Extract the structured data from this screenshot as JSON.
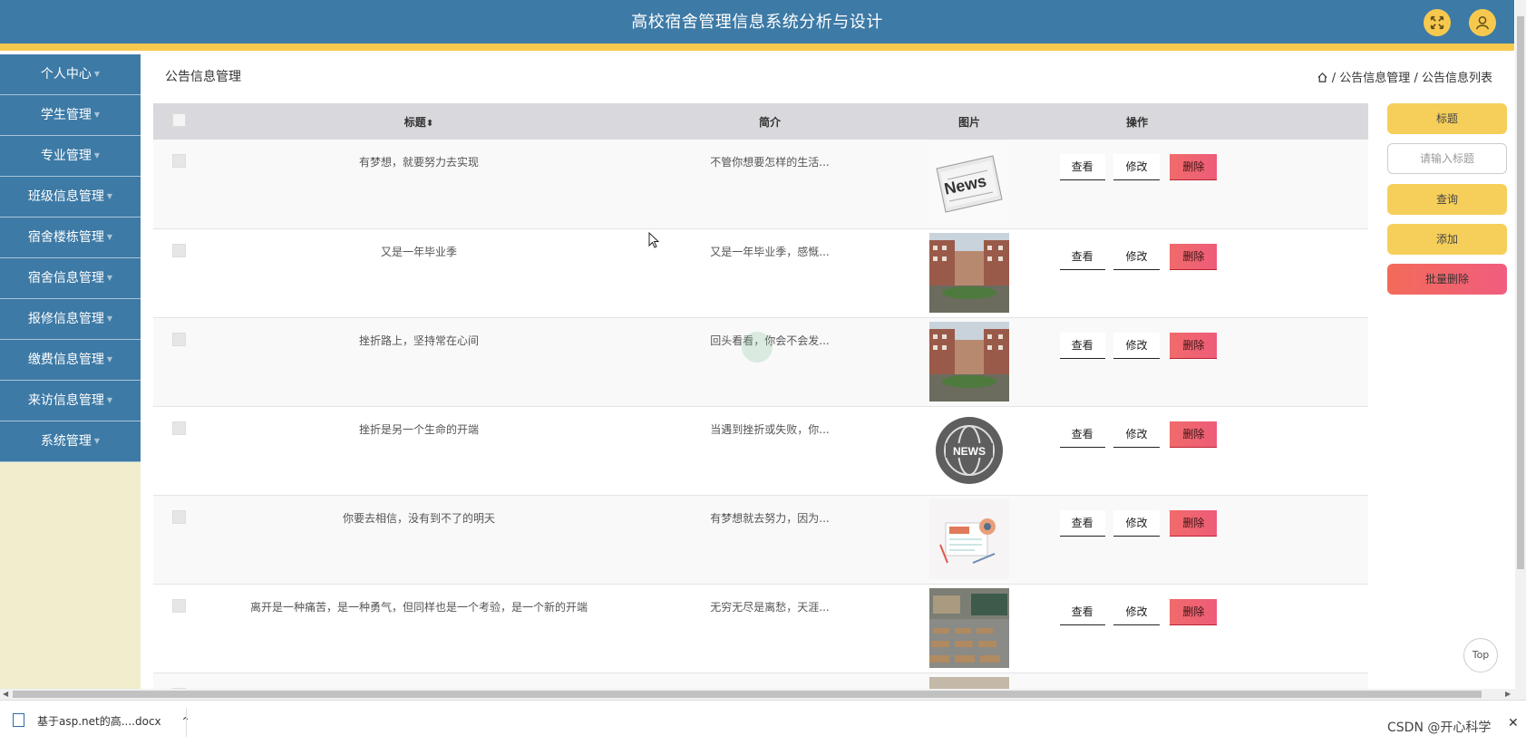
{
  "header": {
    "title": "高校宿舍管理信息系统分析与设计"
  },
  "sidebar": {
    "items": [
      {
        "label": "个人中心"
      },
      {
        "label": "学生管理"
      },
      {
        "label": "专业管理"
      },
      {
        "label": "班级信息管理"
      },
      {
        "label": "宿舍楼栋管理"
      },
      {
        "label": "宿舍信息管理"
      },
      {
        "label": "报修信息管理"
      },
      {
        "label": "缴费信息管理"
      },
      {
        "label": "来访信息管理"
      },
      {
        "label": "系统管理"
      }
    ]
  },
  "page": {
    "title": "公告信息管理",
    "breadcrumb": [
      "公告信息管理",
      "公告信息列表"
    ],
    "breadcrumb_sep": "/"
  },
  "table": {
    "headers": {
      "title": "标题",
      "summary": "简介",
      "image": "图片",
      "ops": "操作"
    },
    "sort_glyph": "⬍",
    "rows": [
      {
        "title": "有梦想，就要努力去实现",
        "summary": "不管你想要怎样的生活...",
        "image": "newspaper"
      },
      {
        "title": "又是一年毕业季",
        "summary": "又是一年毕业季，感慨...",
        "image": "campus"
      },
      {
        "title": "挫折路上，坚持常在心间",
        "summary": "回头看看，你会不会发...",
        "image": "campus"
      },
      {
        "title": "挫折是另一个生命的开端",
        "summary": "当遇到挫折或失败，你...",
        "image": "news-globe"
      },
      {
        "title": "你要去相信，没有到不了的明天",
        "summary": "有梦想就去努力，因为...",
        "image": "news-illustration"
      },
      {
        "title": "离开是一种痛苦，是一种勇气，但同样也是一个考验，是一个新的开端",
        "summary": "无穷无尽是离愁，天涯...",
        "image": "classroom"
      }
    ],
    "actions": {
      "view": "查看",
      "edit": "修改",
      "delete": "删除"
    }
  },
  "right_panel": {
    "label_btn": "标题",
    "search_placeholder": "请输入标题",
    "query_btn": "查询",
    "add_btn": "添加",
    "batch_delete_btn": "批量删除"
  },
  "top_button": "Top",
  "downloads": {
    "file": "基于asp.net的高....docx",
    "caret": "⌃",
    "close": "✕"
  },
  "watermark": "CSDN @",
  "watermark_handle": "开心科学",
  "colors": {
    "primary": "#3d7aa6",
    "accent": "#f6c94e",
    "danger": "#f06b6b",
    "sidebar_bg": "#f0eecc"
  }
}
